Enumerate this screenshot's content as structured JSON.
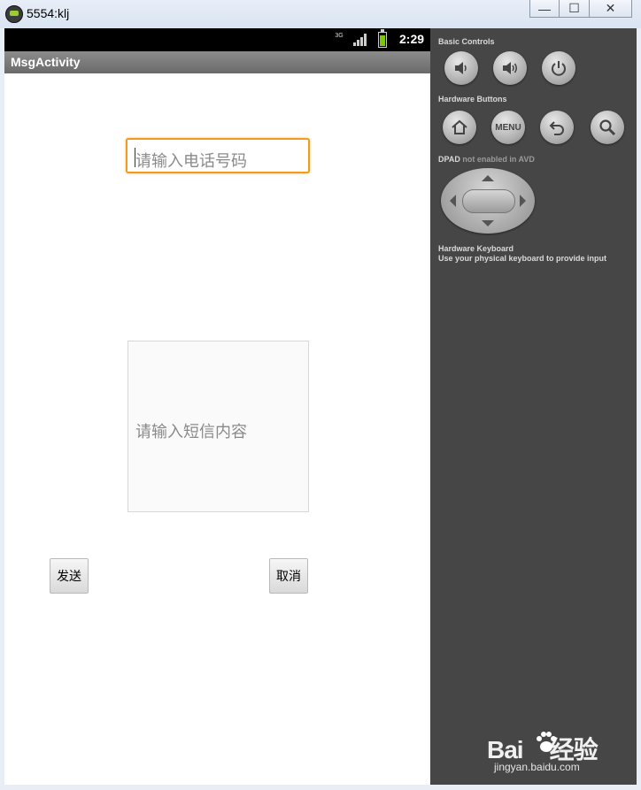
{
  "window": {
    "title": "5554:klj",
    "minimize_symbol": "—",
    "maximize_symbol": "☐",
    "close_symbol": "✕"
  },
  "statusbar": {
    "network": "3G",
    "time": "2:29"
  },
  "app": {
    "activity_title": "MsgActivity"
  },
  "form": {
    "phone_placeholder": "请输入电话号码",
    "message_placeholder": "请输入短信内容",
    "send_label": "发送",
    "cancel_label": "取消"
  },
  "controls": {
    "basic_controls_title": "Basic Controls",
    "hardware_buttons_title": "Hardware Buttons",
    "menu_label": "MENU",
    "dpad_title": "DPAD",
    "dpad_note": "not enabled in AVD",
    "keyboard_title": "Hardware Keyboard",
    "keyboard_note": "Use your physical keyboard to provide input"
  },
  "watermark": {
    "brand": "Bai",
    "brand2": "经验",
    "url": "jingyan.baidu.com"
  },
  "colors": {
    "focus_orange": "#f49b1f",
    "battery_green": "#7ac70c",
    "panel_bg": "#464646"
  }
}
